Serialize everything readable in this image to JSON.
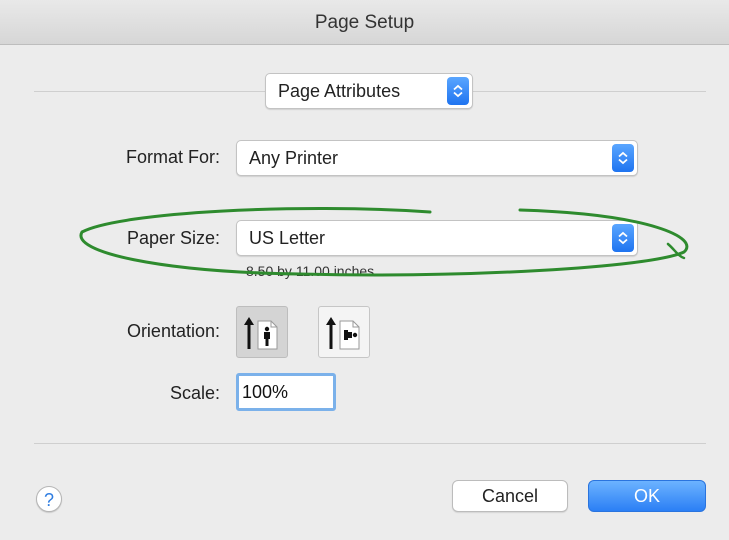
{
  "window": {
    "title": "Page Setup"
  },
  "settings_menu": {
    "selected": "Page Attributes"
  },
  "format_for": {
    "label": "Format For:",
    "value": "Any Printer"
  },
  "paper_size": {
    "label": "Paper Size:",
    "value": "US Letter",
    "dimensions": "8.50 by 11.00 inches"
  },
  "orientation": {
    "label": "Orientation:",
    "selected": "portrait"
  },
  "scale": {
    "label": "Scale:",
    "value": "100%"
  },
  "buttons": {
    "help": "?",
    "cancel": "Cancel",
    "ok": "OK"
  },
  "colors": {
    "accent": "#2b7ff5",
    "annotation": "#2e8b2e"
  }
}
